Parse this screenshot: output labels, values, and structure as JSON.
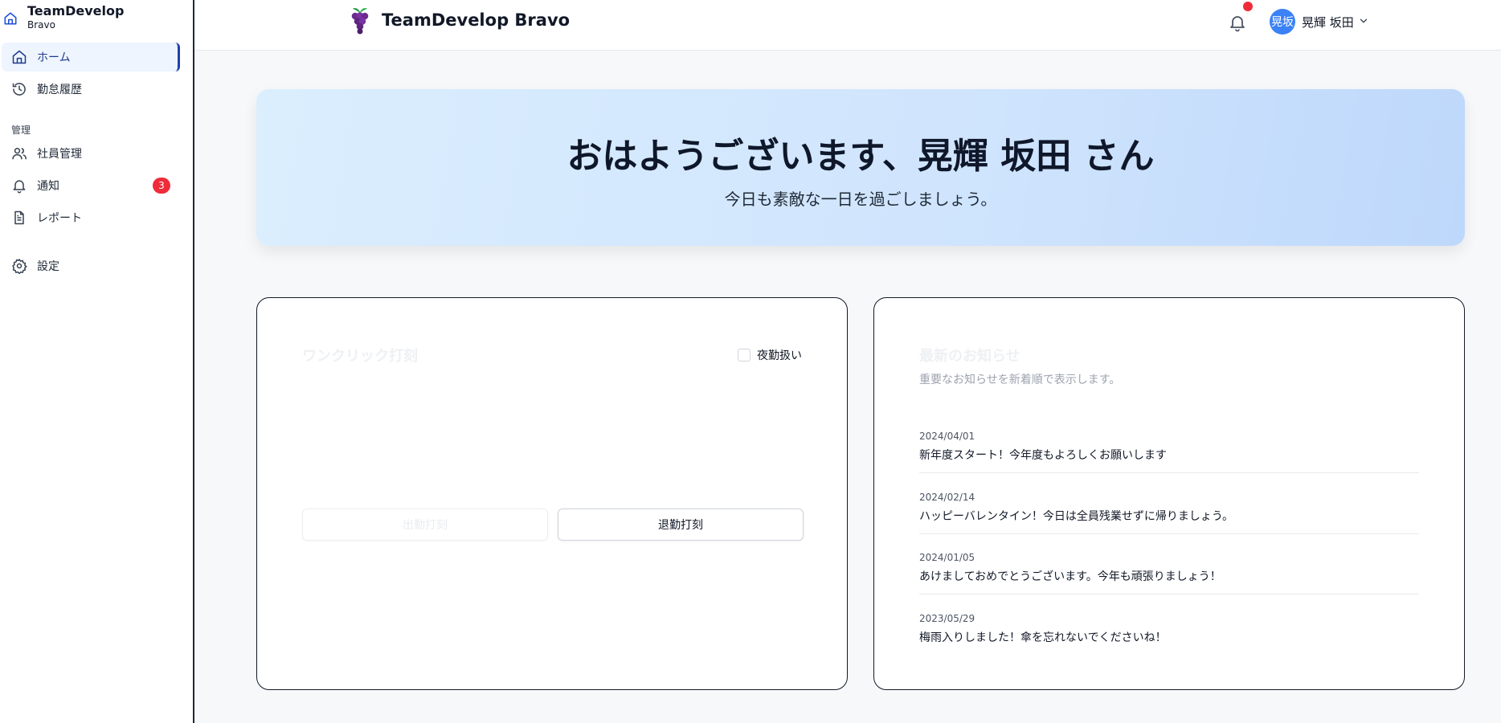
{
  "brand": {
    "title": "TeamDevelop",
    "subtitle": "Bravo"
  },
  "sidebar": {
    "items": [
      {
        "label": "ホーム",
        "icon": "home-icon",
        "active": true
      },
      {
        "label": "勤怠履歴",
        "icon": "history-icon"
      }
    ],
    "section_label": "管理",
    "admin_items": [
      {
        "label": "社員管理",
        "icon": "users-icon"
      },
      {
        "label": "通知",
        "icon": "bell-icon",
        "badge": "3"
      },
      {
        "label": "レポート",
        "icon": "document-icon"
      }
    ],
    "settings_label": "設定"
  },
  "header": {
    "app_title": "TeamDevelop Bravo",
    "avatar_text": "晃坂",
    "user_name": "晃輝 坂田"
  },
  "hero": {
    "title": "おはようございます、晃輝 坂田 さん",
    "subtitle": "今日も素敵な一日を過ごしましょう。"
  },
  "punch_card": {
    "title": "ワンクリック打刻",
    "night_label": "夜勤扱い",
    "clock_in_label": "出勤打刻",
    "clock_out_label": "退勤打刻"
  },
  "news_card": {
    "title": "最新のお知らせ",
    "description": "重要なお知らせを新着順で表示します。",
    "items": [
      {
        "date": "2024/04/01",
        "text": "新年度スタート！今年度もよろしくお願いします"
      },
      {
        "date": "2024/02/14",
        "text": "ハッピーバレンタイン！今日は全員残業せずに帰りましょう。"
      },
      {
        "date": "2024/01/05",
        "text": "あけましておめでとうございます。今年も頑張りましょう！"
      },
      {
        "date": "2023/05/29",
        "text": "梅雨入りしました！傘を忘れないでくださいね！"
      }
    ]
  },
  "colors": {
    "accent": "#1e40af",
    "badge": "#ef2c3a",
    "avatar": "#3b82f6"
  }
}
